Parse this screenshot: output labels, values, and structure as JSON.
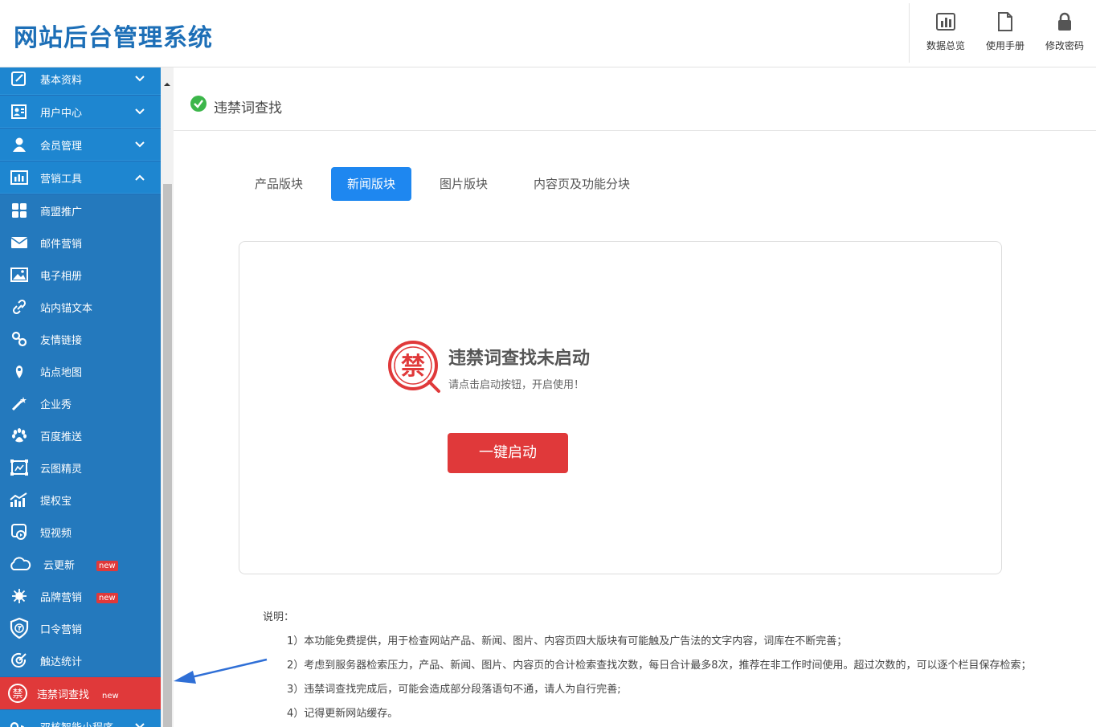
{
  "header": {
    "logo": "网站后台管理系统",
    "buttons": [
      {
        "label": "数据总览",
        "icon": "bar-chart-icon"
      },
      {
        "label": "使用手册",
        "icon": "document-icon"
      },
      {
        "label": "修改密码",
        "icon": "lock-icon"
      }
    ]
  },
  "sidebar": {
    "top_items": [
      {
        "label": "基本资料",
        "icon": "edit-icon",
        "expanded": false
      },
      {
        "label": "用户中心",
        "icon": "user-card-icon",
        "expanded": false
      },
      {
        "label": "会员管理",
        "icon": "person-icon",
        "expanded": false
      },
      {
        "label": "营销工具",
        "icon": "chart-icon",
        "expanded": true
      }
    ],
    "sub_items": [
      {
        "label": "商盟推广",
        "icon": "grid-icon"
      },
      {
        "label": "邮件营销",
        "icon": "mail-icon"
      },
      {
        "label": "电子相册",
        "icon": "image-icon"
      },
      {
        "label": "站内锚文本",
        "icon": "link-icon"
      },
      {
        "label": "友情链接",
        "icon": "chain-icon"
      },
      {
        "label": "站点地图",
        "icon": "location-pin-icon"
      },
      {
        "label": "企业秀",
        "icon": "magic-wand-icon"
      },
      {
        "label": "百度推送",
        "icon": "paw-icon"
      },
      {
        "label": "云图精灵",
        "icon": "frame-icon"
      },
      {
        "label": "提权宝",
        "icon": "trend-icon"
      },
      {
        "label": "短视频",
        "icon": "video-icon"
      },
      {
        "label": "云更新",
        "icon": "cloud-icon",
        "badge": "new"
      },
      {
        "label": "品牌营销",
        "icon": "virus-icon",
        "badge": "new"
      },
      {
        "label": "口令营销",
        "icon": "shield-icon"
      },
      {
        "label": "触达统计",
        "icon": "target-icon"
      },
      {
        "label": "违禁词查找",
        "icon": "ban-word-icon",
        "badge": "new",
        "active": true
      }
    ],
    "bottom_item": {
      "label": "双核智能小程序",
      "icon": "mini-program-icon"
    }
  },
  "page": {
    "title": "违禁词查找",
    "tabs": [
      {
        "label": "产品版块",
        "active": false
      },
      {
        "label": "新闻版块",
        "active": true
      },
      {
        "label": "图片版块",
        "active": false
      },
      {
        "label": "内容页及功能分块",
        "active": false
      }
    ],
    "card": {
      "icon_char": "禁",
      "title": "违禁词查找未启动",
      "subtitle": "请点击启动按钮，开启使用！",
      "button": "一键启动"
    },
    "notes_title": "说明：",
    "notes": [
      "1）本功能免费提供，用于检查网站产品、新闻、图片、内容页四大版块有可能触及广告法的文字内容，词库在不断完善；",
      "2）考虑到服务器检索压力，产品、新闻、图片、内容页的合计检索查找次数，每日合计最多8次，推荐在非工作时间使用。超过次数的，可以逐个栏目保存检索；",
      "3）违禁词查找完成后，可能会造成部分段落语句不通，请人为自行完善;",
      "4）记得更新网站缓存。"
    ]
  },
  "colors": {
    "sidebar_bg": "#1f6fb8",
    "sidebar_top": "#1e86d0",
    "active_red": "#e0393a",
    "tab_blue": "#1e87f0",
    "logo_blue": "#1d6fb7"
  }
}
